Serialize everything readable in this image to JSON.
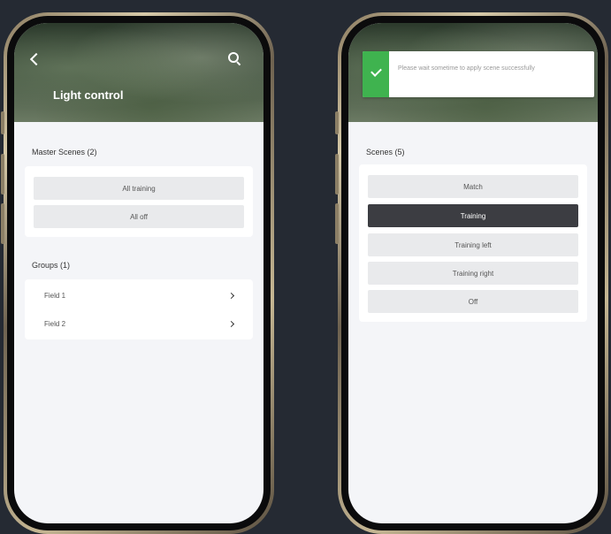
{
  "left_screen": {
    "header": {
      "title": "Light control"
    },
    "master_scenes": {
      "title": "Master Scenes (2)",
      "buttons": [
        "All training",
        "All off"
      ]
    },
    "groups": {
      "title": "Groups (1)",
      "items": [
        "Field 1",
        "Field 2"
      ]
    }
  },
  "right_screen": {
    "toast": {
      "message": "Please wait sometime to apply scene successfully"
    },
    "scenes": {
      "title": "Scenes (5)",
      "buttons": [
        "Match",
        "Training",
        "Training left",
        "Training right",
        "Off"
      ],
      "active": "Training"
    }
  },
  "colors": {
    "background": "#252a33",
    "success_accent": "#3fb34f",
    "active_scene": "#3c3d42"
  }
}
